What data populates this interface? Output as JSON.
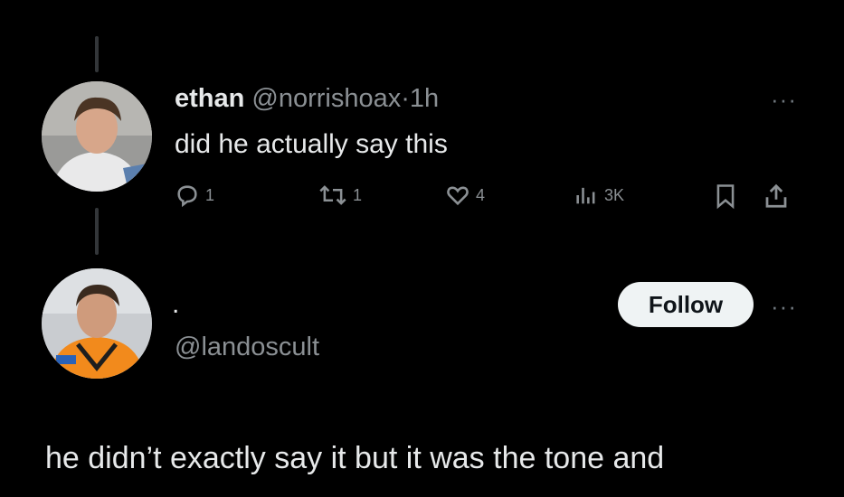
{
  "tweet": {
    "display_name": "ethan",
    "handle": "@norrishoax",
    "separator": "·",
    "time": "1h",
    "text": "did he actually say this",
    "more_label": "···",
    "actions": {
      "replies": "1",
      "retweets": "1",
      "likes": "4",
      "views": "3K"
    }
  },
  "reply": {
    "display_name": ".",
    "handle": "@landoscult",
    "follow_label": "Follow",
    "more_label": "···",
    "text": "he didn’t exactly say it but it was the tone and"
  },
  "colors": {
    "background": "#000000",
    "primary_text": "#e7e9ea",
    "secondary_text": "#8b9094",
    "follow_bg": "#eff3f4",
    "orange_accent": "#f28a1c"
  }
}
